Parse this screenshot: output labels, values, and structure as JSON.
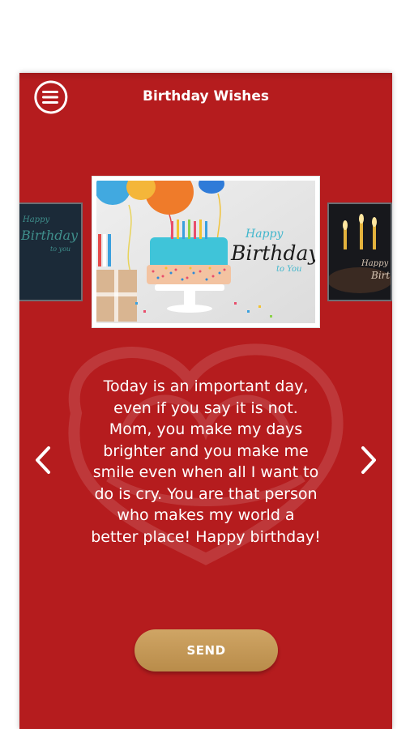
{
  "header": {
    "title": "Birthday Wishes",
    "menu_icon": "menu-icon"
  },
  "carousel": {
    "left_card": {
      "line1": "Happy",
      "line2": "Birthday",
      "line3": "to you"
    },
    "main_card": {
      "line1": "Happy",
      "line2": "Birthday",
      "line3": "to You"
    },
    "right_card": {
      "line1": "Happy",
      "line2": "Birt"
    }
  },
  "message": {
    "lines": [
      "Today is an important day,",
      "even if you say it is not.",
      "Mom, you make my days",
      "brighter and you make me",
      "smile even when all I want to",
      "do is cry. You are that person",
      "who makes my world a",
      "better place! Happy birthday!"
    ]
  },
  "nav": {
    "prev_icon": "chevron-left-icon",
    "next_icon": "chevron-right-icon"
  },
  "send": {
    "label": "SEND"
  },
  "colors": {
    "background": "#b51c1e",
    "button": "#c49a58",
    "text": "#ffffff"
  }
}
